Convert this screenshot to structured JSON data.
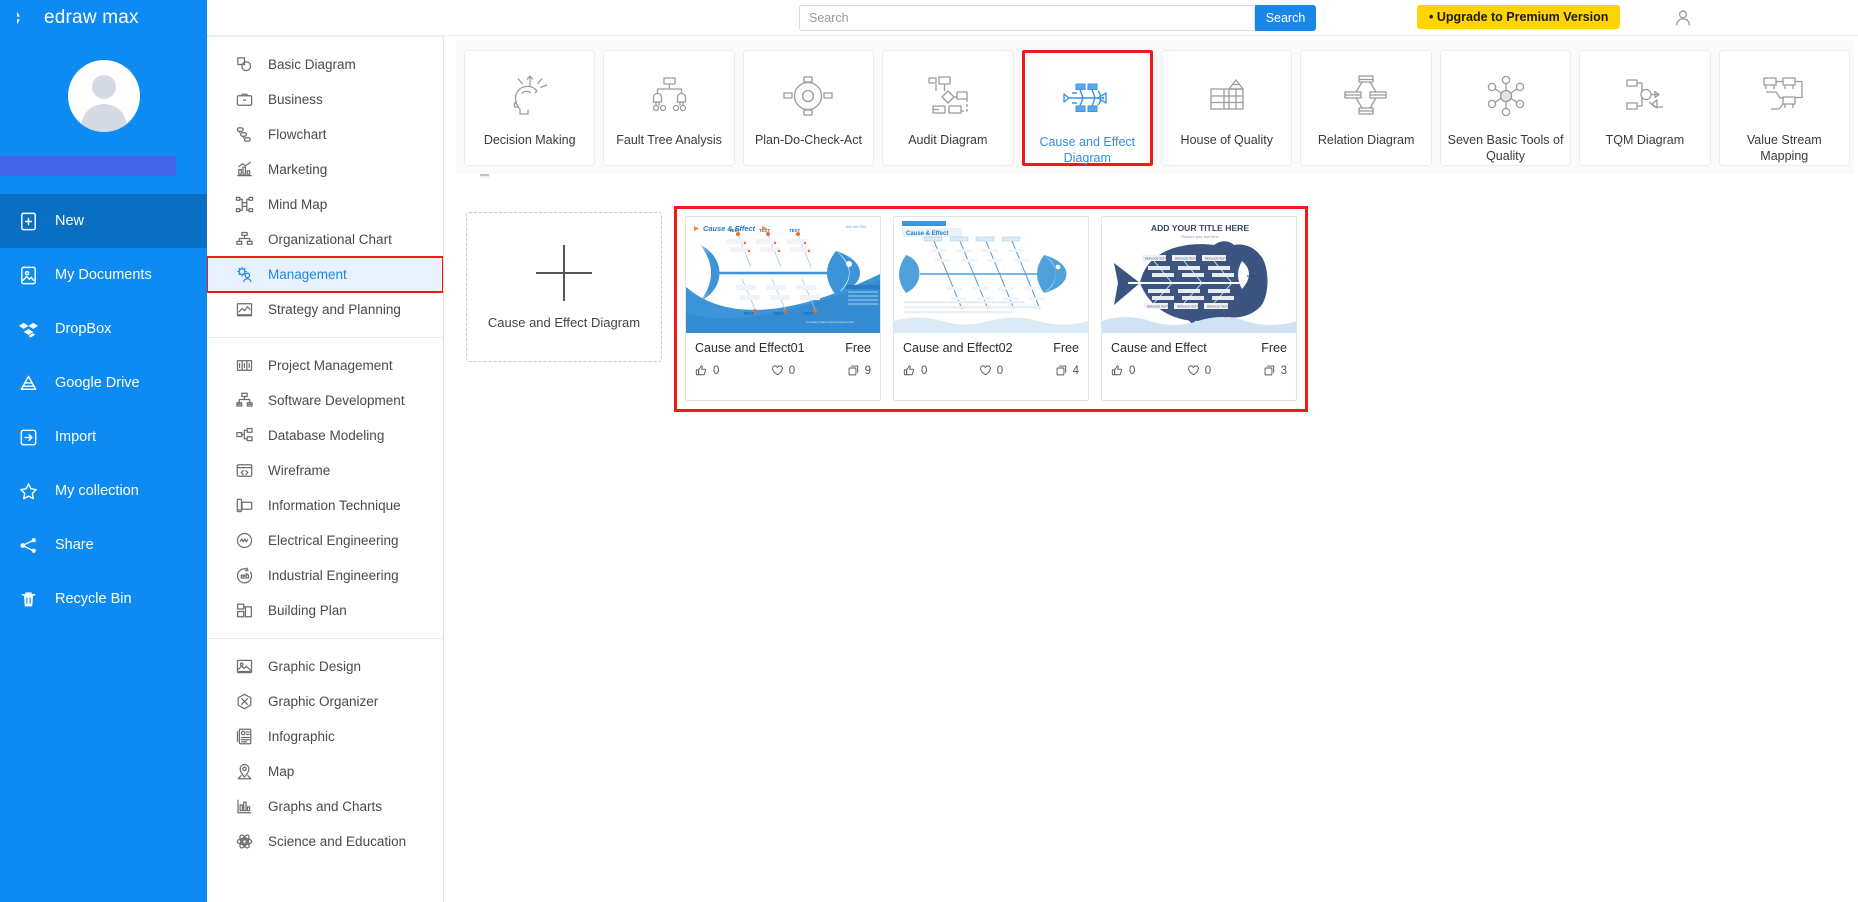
{
  "app": {
    "brand": "edraw max"
  },
  "header": {
    "search_placeholder": "Search",
    "search_value": "",
    "search_button": "Search",
    "upgrade_button": "• Upgrade to Premium Version",
    "user_icon": "user-account-icon"
  },
  "sidebar": {
    "items": [
      {
        "label": "New",
        "icon": "new-document-icon",
        "active": true
      },
      {
        "label": "My Documents",
        "icon": "my-documents-icon",
        "active": false
      },
      {
        "label": "DropBox",
        "icon": "dropbox-icon",
        "active": false
      },
      {
        "label": "Google Drive",
        "icon": "google-drive-icon",
        "active": false
      },
      {
        "label": "Import",
        "icon": "import-icon",
        "active": false
      },
      {
        "label": "My collection",
        "icon": "star-icon",
        "active": false
      },
      {
        "label": "Share",
        "icon": "share-icon",
        "active": false
      },
      {
        "label": "Recycle Bin",
        "icon": "trash-icon",
        "active": false
      }
    ]
  },
  "categories": {
    "groups": [
      {
        "items": [
          {
            "label": "Basic Diagram",
            "icon": "basic-diagram-icon",
            "selected": false
          },
          {
            "label": "Business",
            "icon": "briefcase-icon",
            "selected": false
          },
          {
            "label": "Flowchart",
            "icon": "flowchart-icon",
            "selected": false
          },
          {
            "label": "Marketing",
            "icon": "bar-chart-icon",
            "selected": false
          },
          {
            "label": "Mind Map",
            "icon": "mind-map-icon",
            "selected": false
          },
          {
            "label": "Organizational Chart",
            "icon": "org-chart-icon",
            "selected": false
          },
          {
            "label": "Management",
            "icon": "management-gear-person-icon",
            "selected": true
          },
          {
            "label": "Strategy and Planning",
            "icon": "line-chart-icon",
            "selected": false
          }
        ]
      },
      {
        "items": [
          {
            "label": "Project Management",
            "icon": "project-management-icon",
            "selected": false
          },
          {
            "label": "Software Development",
            "icon": "software-development-icon",
            "selected": false
          },
          {
            "label": "Database Modeling",
            "icon": "database-modeling-icon",
            "selected": false
          },
          {
            "label": "Wireframe",
            "icon": "wireframe-code-icon",
            "selected": false
          },
          {
            "label": "Information Technique",
            "icon": "information-technique-icon",
            "selected": false
          },
          {
            "label": "Electrical Engineering",
            "icon": "electrical-engineering-icon",
            "selected": false
          },
          {
            "label": "Industrial Engineering",
            "icon": "industrial-engineering-icon",
            "selected": false
          },
          {
            "label": "Building Plan",
            "icon": "building-plan-icon",
            "selected": false
          }
        ]
      },
      {
        "items": [
          {
            "label": "Graphic Design",
            "icon": "graphic-design-icon",
            "selected": false
          },
          {
            "label": "Graphic Organizer",
            "icon": "graphic-organizer-icon",
            "selected": false
          },
          {
            "label": "Infographic",
            "icon": "infographic-icon",
            "selected": false
          },
          {
            "label": "Map",
            "icon": "map-pin-icon",
            "selected": false
          },
          {
            "label": "Graphs and Charts",
            "icon": "graphs-and-charts-icon",
            "selected": false
          },
          {
            "label": "Science and Education",
            "icon": "science-education-icon",
            "selected": false
          }
        ]
      }
    ],
    "scroll_up_arrow": "▲"
  },
  "type_strip": {
    "cards": [
      {
        "label": "Decision Making",
        "icon": "decision-making-icon",
        "active": false
      },
      {
        "label": "Fault Tree Analysis",
        "icon": "fault-tree-icon",
        "active": false
      },
      {
        "label": "Plan-Do-Check-Act",
        "icon": "pdca-cycle-icon",
        "active": false
      },
      {
        "label": "Audit Diagram",
        "icon": "audit-diagram-icon",
        "active": false
      },
      {
        "label": "Cause and Effect Diagram",
        "icon": "fishbone-icon",
        "active": true
      },
      {
        "label": "House of Quality",
        "icon": "house-of-quality-icon",
        "active": false
      },
      {
        "label": "Relation Diagram",
        "icon": "relation-diagram-icon",
        "active": false
      },
      {
        "label": "Seven Basic Tools of Quality",
        "icon": "seven-tools-icon",
        "active": false
      },
      {
        "label": "TQM Diagram",
        "icon": "tqm-diagram-icon",
        "active": false
      },
      {
        "label": "Value Stream Mapping",
        "icon": "value-stream-icon",
        "active": false
      }
    ]
  },
  "results": {
    "blank_card": {
      "label": "Cause and Effect Diagram",
      "icon": "plus-icon"
    },
    "templates": [
      {
        "title": "Cause and Effect01",
        "price": "Free",
        "likes": "0",
        "favorites": "0",
        "copies": "9",
        "thumb_title": "Cause & Effect",
        "thumb_style": "blue-fishbone"
      },
      {
        "title": "Cause and Effect02",
        "price": "Free",
        "likes": "0",
        "favorites": "0",
        "copies": "4",
        "thumb_title": "Cause & Effect",
        "thumb_style": "light-fishbone"
      },
      {
        "title": "Cause and Effect",
        "price": "Free",
        "likes": "0",
        "favorites": "0",
        "copies": "3",
        "thumb_title": "ADD YOUR TITLE HERE",
        "thumb_subtitle": "Replace your text here!",
        "thumb_style": "navy-fish"
      }
    ]
  },
  "colors": {
    "sidebar_blue": "#0d8bf2",
    "sidebar_active": "#0a6fc2",
    "accent_blue": "#1a86e8",
    "highlight_red": "#f41818",
    "upgrade_yellow": "#ffd400",
    "name_bar": "#4464e8"
  }
}
